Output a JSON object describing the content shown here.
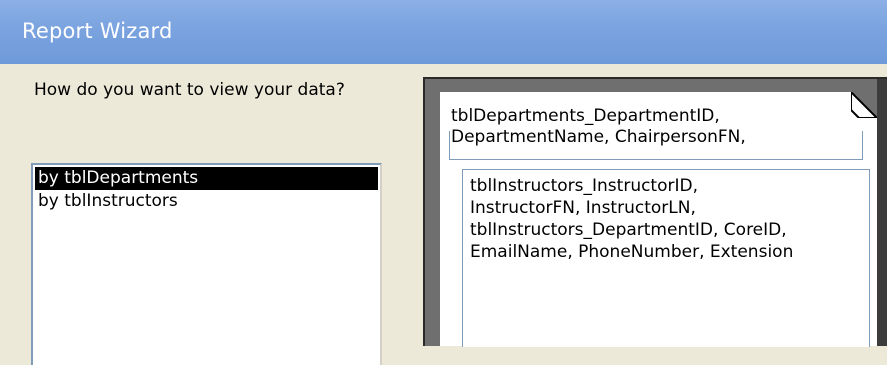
{
  "window": {
    "title": "Report Wizard"
  },
  "prompt": "How do you want to view your data?",
  "view_list": {
    "items": [
      {
        "label": "by tblDepartments",
        "selected": true
      },
      {
        "label": "by tblInstructors",
        "selected": false
      }
    ]
  },
  "preview": {
    "group_header": "tblDepartments_DepartmentID,\nDepartmentName, ChairpersonFN,",
    "detail": "tblInstructors_InstructorID,\nInstructorFN, InstructorLN,\ntblInstructors_DepartmentID, CoreID,\nEmailName, PhoneNumber, Extension"
  },
  "colors": {
    "titlebar": "#7aa3df",
    "dialog_bg": "#ece9d8",
    "selection_bg": "#000000",
    "field_border": "#7f9db9"
  }
}
